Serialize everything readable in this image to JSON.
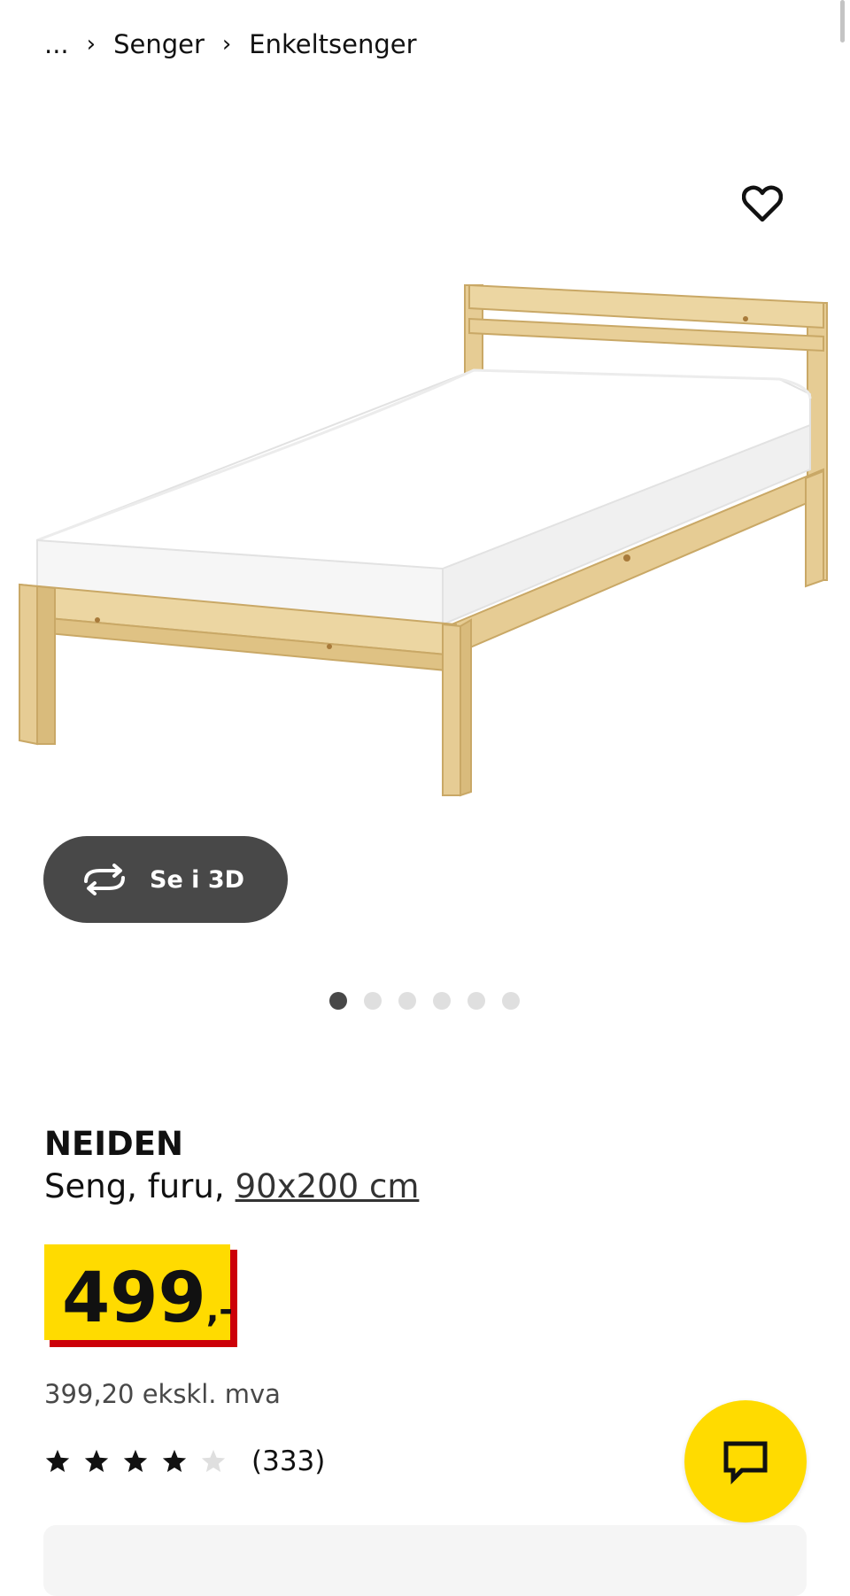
{
  "breadcrumb": {
    "ellipsis": "...",
    "items": [
      "Senger",
      "Enkeltsenger"
    ]
  },
  "gallery": {
    "view_3d_label": "Se i 3D",
    "image_count": 6,
    "active_index": 0
  },
  "product": {
    "name": "NEIDEN",
    "description": "Seng, furu,",
    "size": "90x200 cm",
    "price_integer": "499",
    "price_suffix": ",-",
    "price_ex_vat": "399,20 ekskl. mva",
    "rating_stars": 4,
    "rating_max": 5,
    "review_count": "(333)"
  },
  "colors": {
    "accent_yellow": "#ffdb00",
    "price_shadow_red": "#cc0008",
    "button_dark": "#484848",
    "star_filled": "#111111",
    "star_empty": "#dfdfdf"
  },
  "icons": {
    "favorite": "heart-outline-icon",
    "view_3d": "rotate-arrows-icon",
    "chat": "speech-bubble-icon",
    "star": "star-icon"
  }
}
